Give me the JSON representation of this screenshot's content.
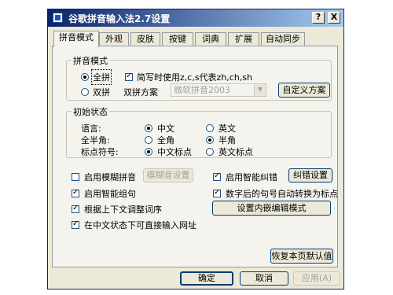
{
  "window": {
    "title": "谷歌拼音输入法2.7设置",
    "help_label": "?",
    "close_label": "X"
  },
  "tabs": [
    {
      "label": "拼音模式"
    },
    {
      "label": "外观"
    },
    {
      "label": "皮肤"
    },
    {
      "label": "按键"
    },
    {
      "label": "词典"
    },
    {
      "label": "扩展"
    },
    {
      "label": "自动同步"
    }
  ],
  "pinyin_mode": {
    "legend": "拼音模式",
    "full_label": "全拼",
    "full_selected": true,
    "abbr_label": "简写时使用z,c,s代表zh,ch,sh",
    "abbr_checked": true,
    "double_label": "双拼",
    "double_selected": false,
    "scheme_label": "双拼方案",
    "scheme_value": "微软拼音2003",
    "custom_button": "自定义方案"
  },
  "initial_state": {
    "legend": "初始状态",
    "language_label": "语言:",
    "chinese": "中文",
    "english": "英文",
    "language_selected": "中文",
    "width_label": "全半角:",
    "full_width": "全角",
    "half_width": "半角",
    "width_selected": "半角",
    "punct_label": "标点符号:",
    "chinese_punct": "中文标点",
    "english_punct": "英文标点",
    "punct_selected": "中文标点"
  },
  "options": {
    "fuzzy_label": "启用模糊拼音",
    "fuzzy_checked": false,
    "fuzzy_button": "模糊音设置",
    "smart_correct_label": "启用智能纠错",
    "smart_correct_checked": true,
    "correct_button": "纠错设置",
    "smart_phrase_label": "启用智能组句",
    "smart_phrase_checked": true,
    "period_label": "数字后的句号自动转换为标点",
    "period_checked": true,
    "context_label": "根据上下文调整词序",
    "context_checked": true,
    "inline_button": "设置内嵌编辑模式",
    "url_label": "在中文状态下可直接输入网址",
    "url_checked": true,
    "restore_button": "恢复本页默认值"
  },
  "footer": {
    "ok": "确定",
    "cancel": "取消",
    "apply": "应用(A)"
  }
}
